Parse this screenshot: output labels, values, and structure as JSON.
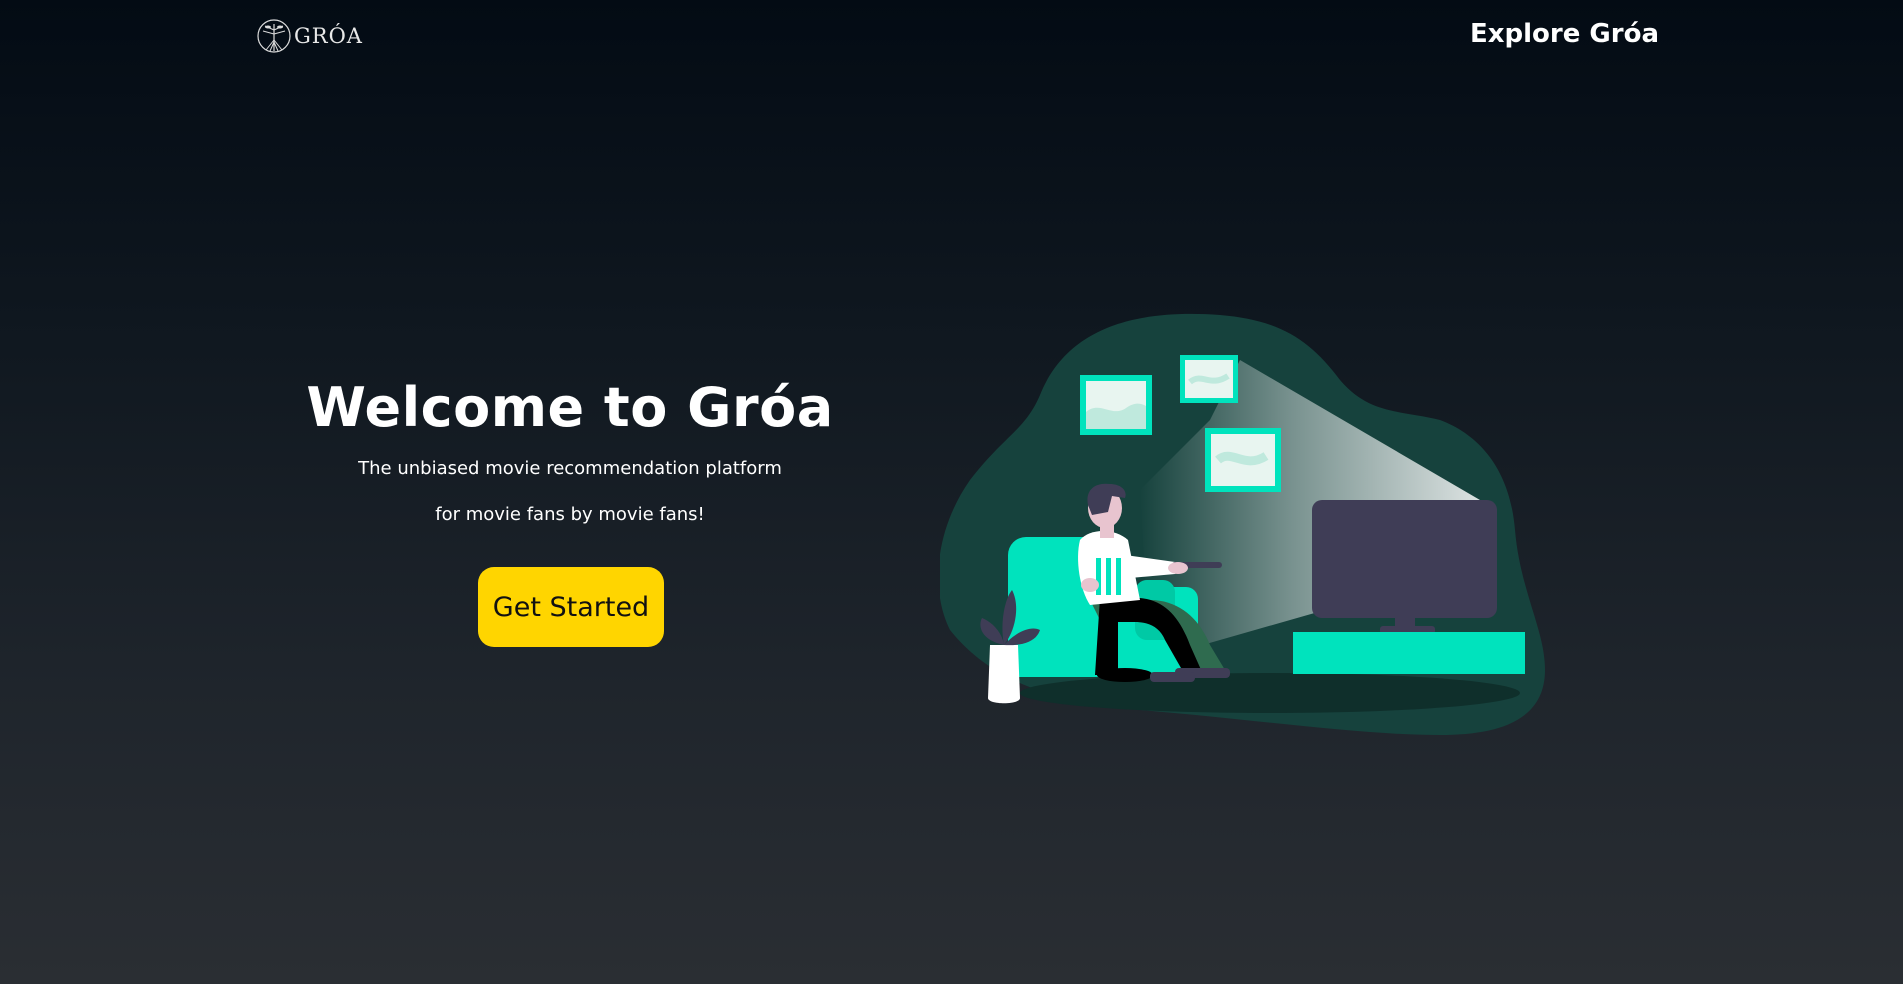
{
  "header": {
    "logo_text": "GRÓA",
    "logo_icon": "tree-emblem-icon",
    "nav_link": "Explore Gróa"
  },
  "hero": {
    "title": "Welcome to Gróa",
    "subtitle_line1": "The unbiased movie recommendation platform",
    "subtitle_line2": "for movie fans by movie fans!",
    "cta_label": "Get Started"
  },
  "illustration": {
    "icon": "person-watching-tv-illustration"
  },
  "colors": {
    "accent_yellow": "#ffd500",
    "accent_teal": "#00e3bd",
    "blob_green": "#16423d",
    "tv_gray": "#3f3d56"
  }
}
